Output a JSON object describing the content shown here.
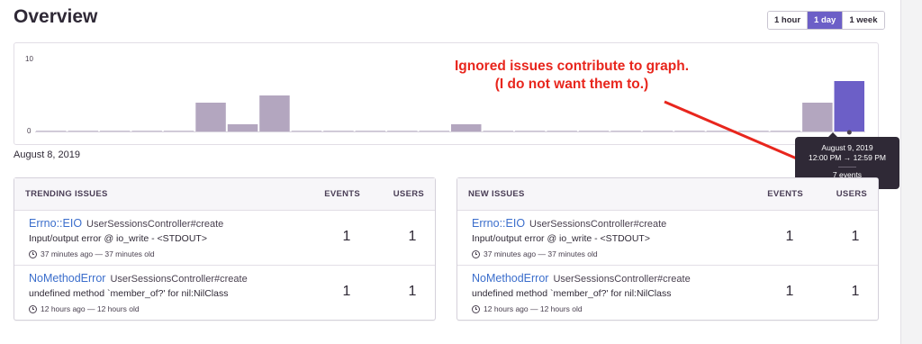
{
  "page": {
    "title": "Overview",
    "date_label": "August 8, 2019"
  },
  "range_selector": {
    "options": [
      {
        "label": "1 hour",
        "active": false
      },
      {
        "label": "1 day",
        "active": true
      },
      {
        "label": "1 week",
        "active": false
      }
    ],
    "active_color": "#6c5fc7"
  },
  "chart_data": {
    "type": "bar",
    "y_ticks": [
      "10",
      "0"
    ],
    "ylim": [
      0,
      10
    ],
    "values": [
      0,
      0,
      0,
      0,
      0,
      4,
      1,
      5,
      0,
      0,
      0,
      0,
      0,
      1,
      0,
      0,
      0,
      0,
      0,
      0,
      0,
      0,
      0,
      0,
      4,
      7
    ],
    "highlight_index": 25,
    "bar_color": "#b3a6bf",
    "highlight_color": "#6c5fc7"
  },
  "annotation": {
    "line1": "Ignored issues contribute to graph.",
    "line2": "(I do not want them to.)",
    "color": "#e8261d"
  },
  "tooltip": {
    "date": "August 9, 2019",
    "range": "12:00 PM → 12:59 PM",
    "count": "7 events"
  },
  "trending": {
    "header": {
      "title": "TRENDING ISSUES",
      "events": "EVENTS",
      "users": "USERS"
    },
    "rows": [
      {
        "type": "Errno::EIO",
        "culprit": "UserSessionsController#create",
        "message": "Input/output error @ io_write - <STDOUT>",
        "time": "37 minutes ago — 37 minutes old",
        "events": "1",
        "users": "1"
      },
      {
        "type": "NoMethodError",
        "culprit": "UserSessionsController#create",
        "message": "undefined method `member_of?' for nil:NilClass",
        "time": "12 hours ago — 12 hours old",
        "events": "1",
        "users": "1"
      }
    ]
  },
  "new_issues": {
    "header": {
      "title": "NEW ISSUES",
      "events": "EVENTS",
      "users": "USERS"
    },
    "rows": [
      {
        "type": "Errno::EIO",
        "culprit": "UserSessionsController#create",
        "message": "Input/output error @ io_write - <STDOUT>",
        "time": "37 minutes ago — 37 minutes old",
        "events": "1",
        "users": "1"
      },
      {
        "type": "NoMethodError",
        "culprit": "UserSessionsController#create",
        "message": "undefined method `member_of?' for nil:NilClass",
        "time": "12 hours ago — 12 hours old",
        "events": "1",
        "users": "1"
      }
    ]
  }
}
